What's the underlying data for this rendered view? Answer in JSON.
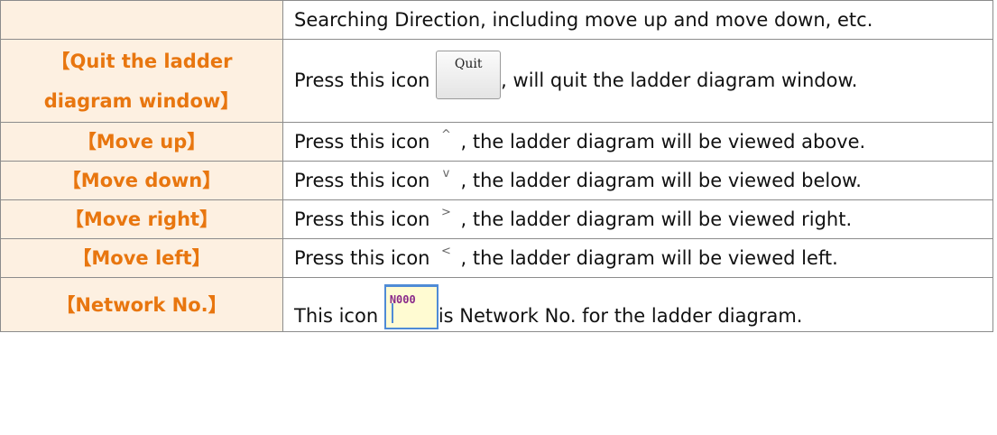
{
  "rows": [
    {
      "term": "",
      "desc": "Searching Direction, including move up and move down, etc."
    },
    {
      "term_line1": "Quit the ladder",
      "term_line2": "diagram window",
      "desc_pre": "Press this icon",
      "icon_label": "Quit",
      "desc_post": ", will quit the ladder diagram window."
    },
    {
      "term": "Move up",
      "desc_pre": "Press this icon",
      "icon_glyph": "^",
      "desc_post": ", the ladder diagram will be viewed above."
    },
    {
      "term": "Move down",
      "desc_pre": "Press this icon",
      "icon_glyph": "v",
      "desc_post": ", the ladder diagram will be viewed below."
    },
    {
      "term": "Move right",
      "desc_pre": "Press this icon",
      "icon_glyph": ">",
      "desc_post": ", the ladder diagram will be viewed right."
    },
    {
      "term": "Move left",
      "desc_pre": "Press this icon",
      "icon_glyph": "<",
      "desc_post": ", the ladder diagram will be viewed left."
    },
    {
      "term": "Network No.",
      "desc_pre": "This icon",
      "icon_label": "N000",
      "desc_post": "is Network No. for the ladder diagram."
    }
  ],
  "brackets": {
    "open": "【",
    "close": "】"
  },
  "colors": {
    "term_text": "#e8760f",
    "term_bg": "#fdf0e1",
    "border": "#8c8c8c"
  }
}
